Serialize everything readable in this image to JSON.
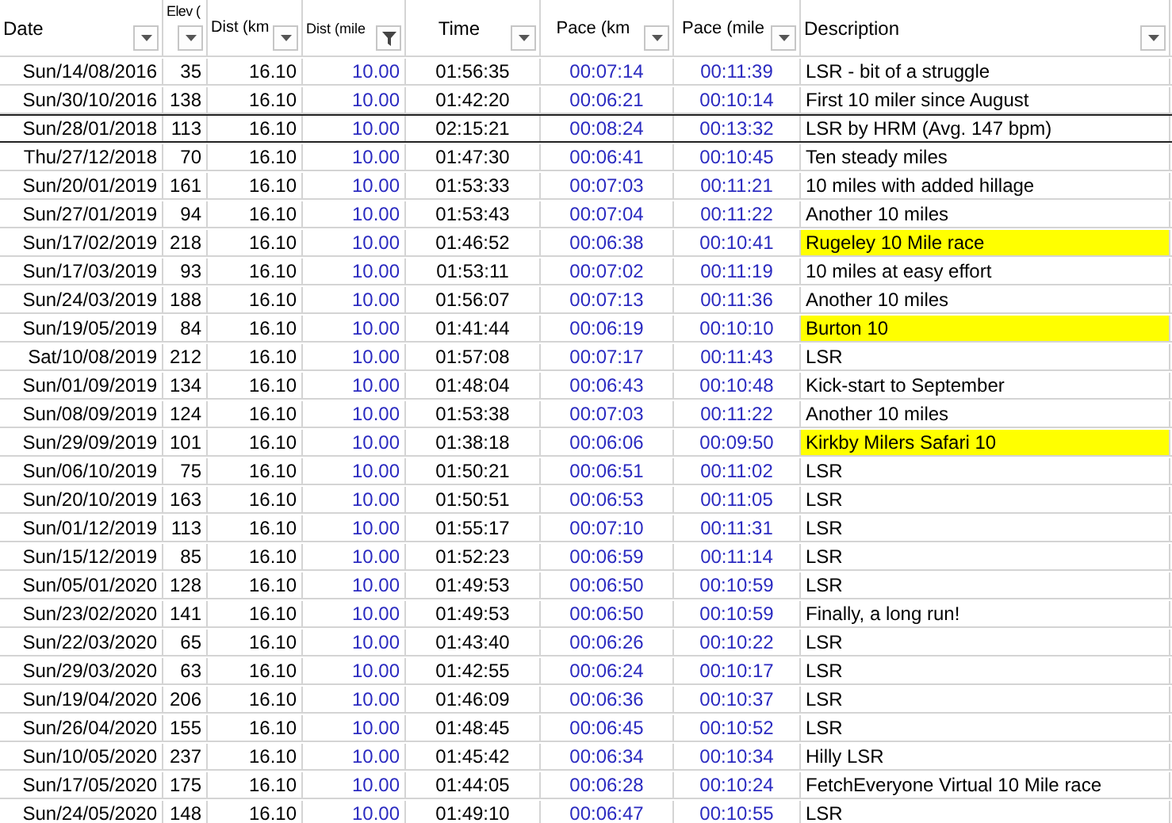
{
  "columns": [
    {
      "label": "Date",
      "filtered": false
    },
    {
      "label": "Elev (",
      "filtered": false
    },
    {
      "label": "Dist (km",
      "filtered": false
    },
    {
      "label": "Dist (mile",
      "filtered": true
    },
    {
      "label": "Time",
      "filtered": false
    },
    {
      "label": "Pace (km",
      "filtered": false
    },
    {
      "label": "Pace (mile",
      "filtered": false
    },
    {
      "label": "Description",
      "filtered": false
    }
  ],
  "rows": [
    {
      "cells": [
        "Sun/14/08/2016",
        "35",
        "16.10",
        "10.00",
        "01:56:35",
        "00:07:14",
        "00:11:39",
        "LSR - bit of a struggle"
      ],
      "highlighted": false,
      "outlined": false
    },
    {
      "cells": [
        "Sun/30/10/2016",
        "138",
        "16.10",
        "10.00",
        "01:42:20",
        "00:06:21",
        "00:10:14",
        "First 10 miler since August"
      ],
      "highlighted": false,
      "outlined": false
    },
    {
      "cells": [
        "Sun/28/01/2018",
        "113",
        "16.10",
        "10.00",
        "02:15:21",
        "00:08:24",
        "00:13:32",
        "LSR by HRM (Avg. 147 bpm)"
      ],
      "highlighted": false,
      "outlined": true
    },
    {
      "cells": [
        "Thu/27/12/2018",
        "70",
        "16.10",
        "10.00",
        "01:47:30",
        "00:06:41",
        "00:10:45",
        "Ten steady miles"
      ],
      "highlighted": false,
      "outlined": false
    },
    {
      "cells": [
        "Sun/20/01/2019",
        "161",
        "16.10",
        "10.00",
        "01:53:33",
        "00:07:03",
        "00:11:21",
        "10 miles with added hillage"
      ],
      "highlighted": false,
      "outlined": false
    },
    {
      "cells": [
        "Sun/27/01/2019",
        "94",
        "16.10",
        "10.00",
        "01:53:43",
        "00:07:04",
        "00:11:22",
        "Another 10 miles"
      ],
      "highlighted": false,
      "outlined": false
    },
    {
      "cells": [
        "Sun/17/02/2019",
        "218",
        "16.10",
        "10.00",
        "01:46:52",
        "00:06:38",
        "00:10:41",
        "Rugeley 10 Mile race"
      ],
      "highlighted": true,
      "outlined": false
    },
    {
      "cells": [
        "Sun/17/03/2019",
        "93",
        "16.10",
        "10.00",
        "01:53:11",
        "00:07:02",
        "00:11:19",
        "10 miles at easy effort"
      ],
      "highlighted": false,
      "outlined": false
    },
    {
      "cells": [
        "Sun/24/03/2019",
        "188",
        "16.10",
        "10.00",
        "01:56:07",
        "00:07:13",
        "00:11:36",
        "Another 10 miles"
      ],
      "highlighted": false,
      "outlined": false
    },
    {
      "cells": [
        "Sun/19/05/2019",
        "84",
        "16.10",
        "10.00",
        "01:41:44",
        "00:06:19",
        "00:10:10",
        "Burton 10"
      ],
      "highlighted": true,
      "outlined": false
    },
    {
      "cells": [
        "Sat/10/08/2019",
        "212",
        "16.10",
        "10.00",
        "01:57:08",
        "00:07:17",
        "00:11:43",
        "LSR"
      ],
      "highlighted": false,
      "outlined": false
    },
    {
      "cells": [
        "Sun/01/09/2019",
        "134",
        "16.10",
        "10.00",
        "01:48:04",
        "00:06:43",
        "00:10:48",
        "Kick-start to September"
      ],
      "highlighted": false,
      "outlined": false
    },
    {
      "cells": [
        "Sun/08/09/2019",
        "124",
        "16.10",
        "10.00",
        "01:53:38",
        "00:07:03",
        "00:11:22",
        "Another 10 miles"
      ],
      "highlighted": false,
      "outlined": false
    },
    {
      "cells": [
        "Sun/29/09/2019",
        "101",
        "16.10",
        "10.00",
        "01:38:18",
        "00:06:06",
        "00:09:50",
        "Kirkby Milers Safari 10"
      ],
      "highlighted": true,
      "outlined": false
    },
    {
      "cells": [
        "Sun/06/10/2019",
        "75",
        "16.10",
        "10.00",
        "01:50:21",
        "00:06:51",
        "00:11:02",
        "LSR"
      ],
      "highlighted": false,
      "outlined": false
    },
    {
      "cells": [
        "Sun/20/10/2019",
        "163",
        "16.10",
        "10.00",
        "01:50:51",
        "00:06:53",
        "00:11:05",
        "LSR"
      ],
      "highlighted": false,
      "outlined": false
    },
    {
      "cells": [
        "Sun/01/12/2019",
        "113",
        "16.10",
        "10.00",
        "01:55:17",
        "00:07:10",
        "00:11:31",
        "LSR"
      ],
      "highlighted": false,
      "outlined": false
    },
    {
      "cells": [
        "Sun/15/12/2019",
        "85",
        "16.10",
        "10.00",
        "01:52:23",
        "00:06:59",
        "00:11:14",
        "LSR"
      ],
      "highlighted": false,
      "outlined": false
    },
    {
      "cells": [
        "Sun/05/01/2020",
        "128",
        "16.10",
        "10.00",
        "01:49:53",
        "00:06:50",
        "00:10:59",
        "LSR"
      ],
      "highlighted": false,
      "outlined": false
    },
    {
      "cells": [
        "Sun/23/02/2020",
        "141",
        "16.10",
        "10.00",
        "01:49:53",
        "00:06:50",
        "00:10:59",
        "Finally, a long run!"
      ],
      "highlighted": false,
      "outlined": false
    },
    {
      "cells": [
        "Sun/22/03/2020",
        "65",
        "16.10",
        "10.00",
        "01:43:40",
        "00:06:26",
        "00:10:22",
        "LSR"
      ],
      "highlighted": false,
      "outlined": false
    },
    {
      "cells": [
        "Sun/29/03/2020",
        "63",
        "16.10",
        "10.00",
        "01:42:55",
        "00:06:24",
        "00:10:17",
        "LSR"
      ],
      "highlighted": false,
      "outlined": false
    },
    {
      "cells": [
        "Sun/19/04/2020",
        "206",
        "16.10",
        "10.00",
        "01:46:09",
        "00:06:36",
        "00:10:37",
        "LSR"
      ],
      "highlighted": false,
      "outlined": false
    },
    {
      "cells": [
        "Sun/26/04/2020",
        "155",
        "16.10",
        "10.00",
        "01:48:45",
        "00:06:45",
        "00:10:52",
        "LSR"
      ],
      "highlighted": false,
      "outlined": false
    },
    {
      "cells": [
        "Sun/10/05/2020",
        "237",
        "16.10",
        "10.00",
        "01:45:42",
        "00:06:34",
        "00:10:34",
        "Hilly LSR"
      ],
      "highlighted": false,
      "outlined": false
    },
    {
      "cells": [
        "Sun/17/05/2020",
        "175",
        "16.10",
        "10.00",
        "01:44:05",
        "00:06:28",
        "00:10:24",
        "FetchEveryone Virtual 10 Mile race"
      ],
      "highlighted": false,
      "outlined": false
    },
    {
      "cells": [
        "Sun/24/05/2020",
        "148",
        "16.10",
        "10.00",
        "01:49:10",
        "00:06:47",
        "00:10:55",
        "LSR"
      ],
      "highlighted": false,
      "outlined": false
    }
  ]
}
